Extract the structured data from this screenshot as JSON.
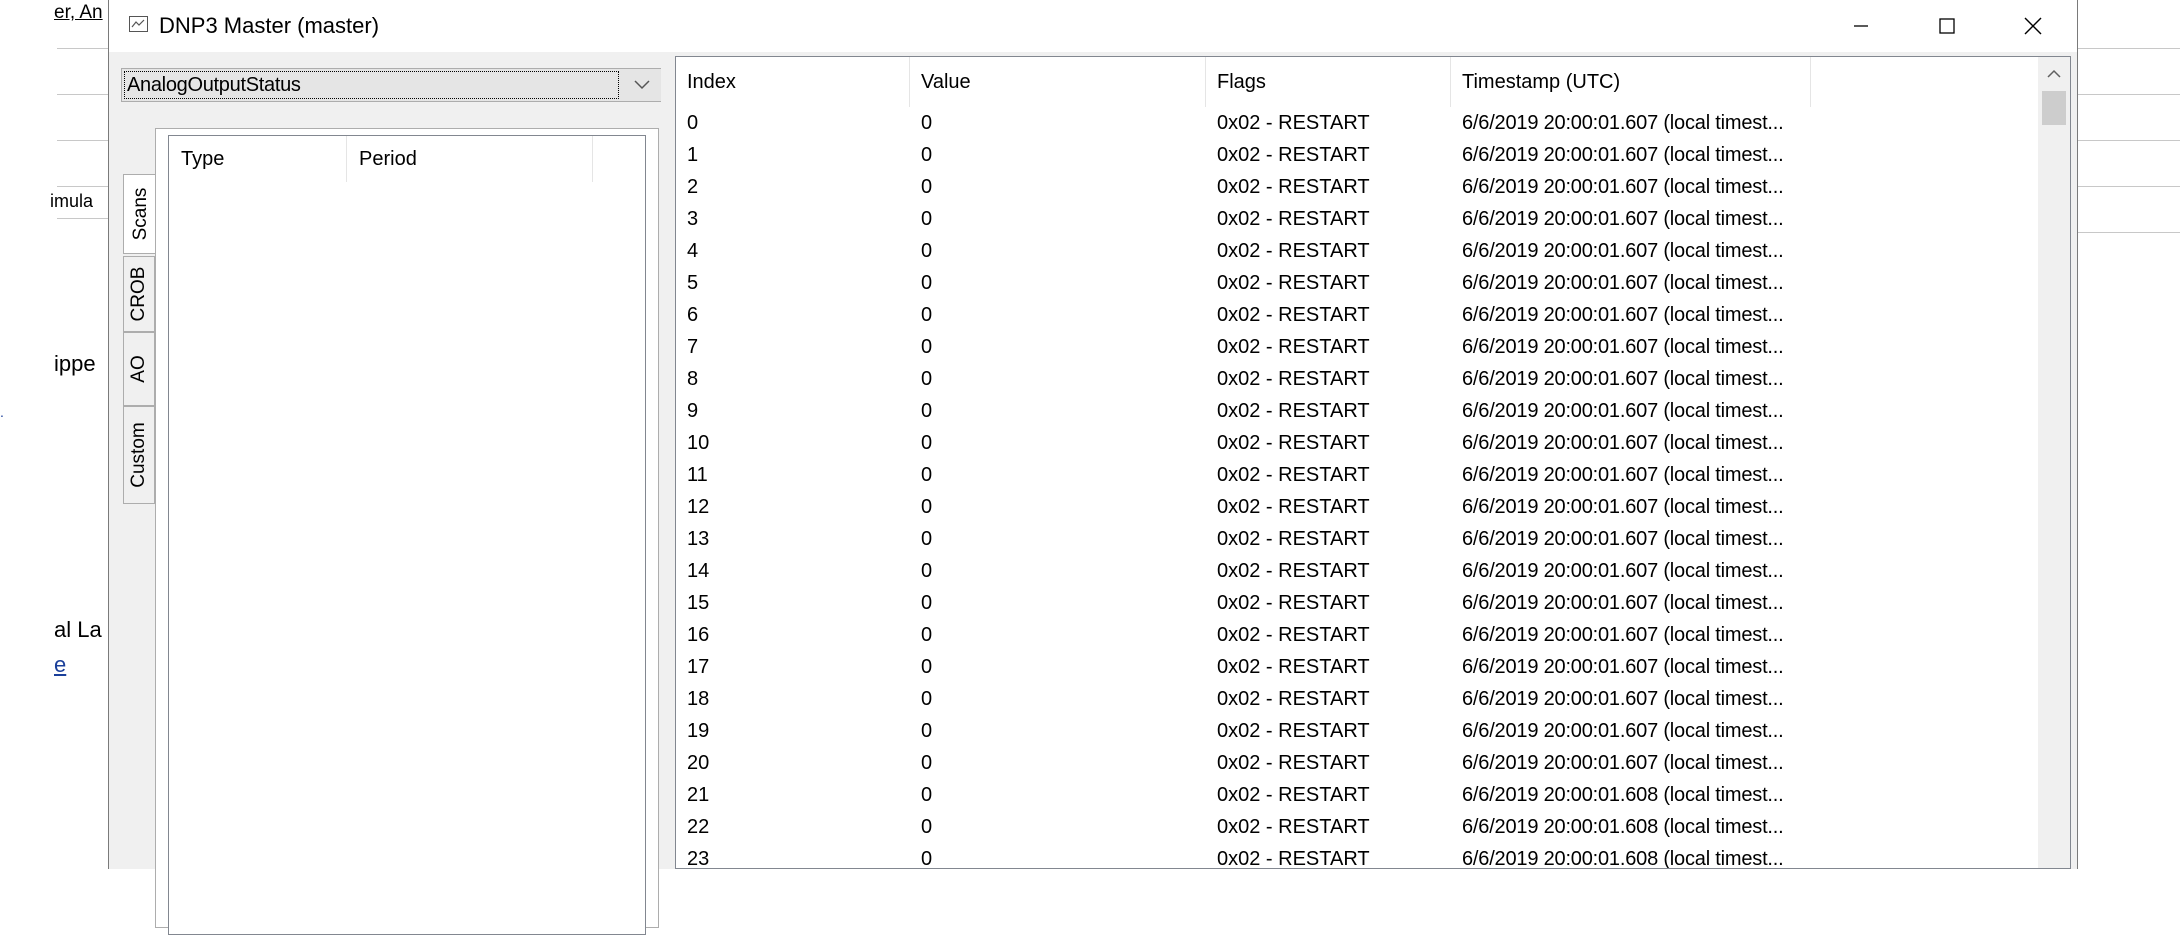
{
  "background": {
    "fragments": [
      "er, An",
      "imula",
      "ippe",
      "al La",
      "e"
    ]
  },
  "window": {
    "title": "DNP3 Master (master)",
    "icon": "chart-window-icon",
    "controls": [
      "minimize",
      "maximize",
      "close"
    ]
  },
  "left_pane": {
    "type_select": {
      "value": "AnalogOutputStatus"
    },
    "tabs": [
      {
        "label": "Scans",
        "active": true
      },
      {
        "label": "CROB",
        "active": false
      },
      {
        "label": "AO",
        "active": false
      },
      {
        "label": "Custom",
        "active": false
      }
    ],
    "scan_table": {
      "columns": [
        "Type",
        "Period"
      ]
    }
  },
  "grid": {
    "columns": [
      "Index",
      "Value",
      "Flags",
      "Timestamp (UTC)"
    ],
    "rows": [
      {
        "index": "0",
        "value": "0",
        "flags": "0x02 - RESTART",
        "timestamp": "6/6/2019 20:00:01.607 (local timest..."
      },
      {
        "index": "1",
        "value": "0",
        "flags": "0x02 - RESTART",
        "timestamp": "6/6/2019 20:00:01.607 (local timest..."
      },
      {
        "index": "2",
        "value": "0",
        "flags": "0x02 - RESTART",
        "timestamp": "6/6/2019 20:00:01.607 (local timest..."
      },
      {
        "index": "3",
        "value": "0",
        "flags": "0x02 - RESTART",
        "timestamp": "6/6/2019 20:00:01.607 (local timest..."
      },
      {
        "index": "4",
        "value": "0",
        "flags": "0x02 - RESTART",
        "timestamp": "6/6/2019 20:00:01.607 (local timest..."
      },
      {
        "index": "5",
        "value": "0",
        "flags": "0x02 - RESTART",
        "timestamp": "6/6/2019 20:00:01.607 (local timest..."
      },
      {
        "index": "6",
        "value": "0",
        "flags": "0x02 - RESTART",
        "timestamp": "6/6/2019 20:00:01.607 (local timest..."
      },
      {
        "index": "7",
        "value": "0",
        "flags": "0x02 - RESTART",
        "timestamp": "6/6/2019 20:00:01.607 (local timest..."
      },
      {
        "index": "8",
        "value": "0",
        "flags": "0x02 - RESTART",
        "timestamp": "6/6/2019 20:00:01.607 (local timest..."
      },
      {
        "index": "9",
        "value": "0",
        "flags": "0x02 - RESTART",
        "timestamp": "6/6/2019 20:00:01.607 (local timest..."
      },
      {
        "index": "10",
        "value": "0",
        "flags": "0x02 - RESTART",
        "timestamp": "6/6/2019 20:00:01.607 (local timest..."
      },
      {
        "index": "11",
        "value": "0",
        "flags": "0x02 - RESTART",
        "timestamp": "6/6/2019 20:00:01.607 (local timest..."
      },
      {
        "index": "12",
        "value": "0",
        "flags": "0x02 - RESTART",
        "timestamp": "6/6/2019 20:00:01.607 (local timest..."
      },
      {
        "index": "13",
        "value": "0",
        "flags": "0x02 - RESTART",
        "timestamp": "6/6/2019 20:00:01.607 (local timest..."
      },
      {
        "index": "14",
        "value": "0",
        "flags": "0x02 - RESTART",
        "timestamp": "6/6/2019 20:00:01.607 (local timest..."
      },
      {
        "index": "15",
        "value": "0",
        "flags": "0x02 - RESTART",
        "timestamp": "6/6/2019 20:00:01.607 (local timest..."
      },
      {
        "index": "16",
        "value": "0",
        "flags": "0x02 - RESTART",
        "timestamp": "6/6/2019 20:00:01.607 (local timest..."
      },
      {
        "index": "17",
        "value": "0",
        "flags": "0x02 - RESTART",
        "timestamp": "6/6/2019 20:00:01.607 (local timest..."
      },
      {
        "index": "18",
        "value": "0",
        "flags": "0x02 - RESTART",
        "timestamp": "6/6/2019 20:00:01.607 (local timest..."
      },
      {
        "index": "19",
        "value": "0",
        "flags": "0x02 - RESTART",
        "timestamp": "6/6/2019 20:00:01.607 (local timest..."
      },
      {
        "index": "20",
        "value": "0",
        "flags": "0x02 - RESTART",
        "timestamp": "6/6/2019 20:00:01.607 (local timest..."
      },
      {
        "index": "21",
        "value": "0",
        "flags": "0x02 - RESTART",
        "timestamp": "6/6/2019 20:00:01.608 (local timest..."
      },
      {
        "index": "22",
        "value": "0",
        "flags": "0x02 - RESTART",
        "timestamp": "6/6/2019 20:00:01.608 (local timest..."
      },
      {
        "index": "23",
        "value": "0",
        "flags": "0x02 - RESTART",
        "timestamp": "6/6/2019 20:00:01.608 (local timest..."
      }
    ]
  }
}
